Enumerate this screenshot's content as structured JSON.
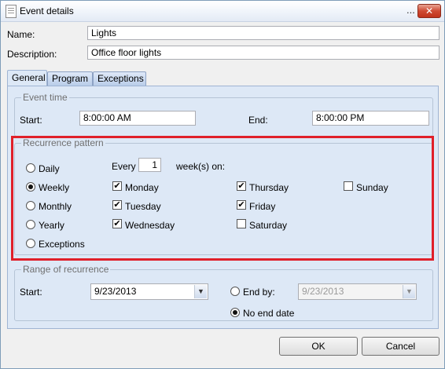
{
  "window": {
    "title": "Event details",
    "ellipsis": "...",
    "close_glyph": "✕"
  },
  "fields": {
    "name_label": "Name:",
    "name_value": "Lights",
    "description_label": "Description:",
    "description_value": "Office floor lights"
  },
  "tabs": [
    {
      "label": "General",
      "active": true
    },
    {
      "label": "Program",
      "active": false
    },
    {
      "label": "Exceptions",
      "active": false
    }
  ],
  "event_time": {
    "group_title": "Event time",
    "start_label": "Start:",
    "start_value": "8:00:00 AM",
    "end_label": "End:",
    "end_value": "8:00:00 PM"
  },
  "recurrence": {
    "group_title": "Recurrence pattern",
    "options": [
      {
        "label": "Daily",
        "selected": false
      },
      {
        "label": "Weekly",
        "selected": true
      },
      {
        "label": "Monthly",
        "selected": false
      },
      {
        "label": "Yearly",
        "selected": false
      },
      {
        "label": "Exceptions",
        "selected": false
      }
    ],
    "every_label": "Every",
    "every_value": "1",
    "weeks_label": "week(s) on:",
    "days": [
      {
        "label": "Monday",
        "checked": true
      },
      {
        "label": "Tuesday",
        "checked": true
      },
      {
        "label": "Wednesday",
        "checked": true
      },
      {
        "label": "Thursday",
        "checked": true
      },
      {
        "label": "Friday",
        "checked": true
      },
      {
        "label": "Saturday",
        "checked": false
      },
      {
        "label": "Sunday",
        "checked": false
      }
    ],
    "check_glyph": "✔"
  },
  "range": {
    "group_title": "Range of recurrence",
    "start_label": "Start:",
    "start_value": "9/23/2013",
    "end_by_label": "End by:",
    "end_by_value": "9/23/2013",
    "no_end_label": "No end date",
    "end_by_selected": false,
    "no_end_selected": true,
    "dropdown_glyph": "▼"
  },
  "buttons": {
    "ok": "OK",
    "cancel": "Cancel"
  },
  "colors": {
    "highlight_border": "#e0202a",
    "panel_bg": "#dde8f6"
  }
}
